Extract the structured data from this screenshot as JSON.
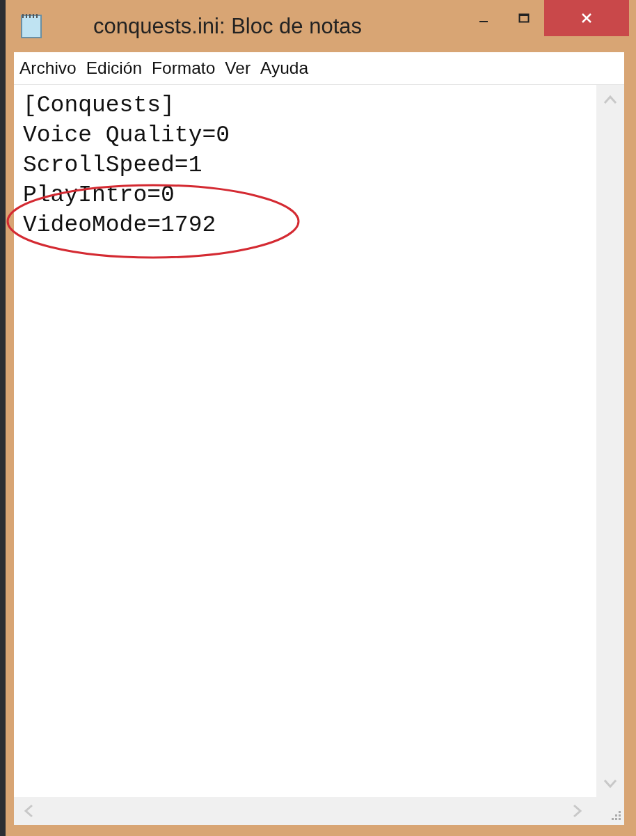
{
  "window": {
    "title": "conquests.ini: Bloc de notas"
  },
  "menu": [
    "Archivo",
    "Edición",
    "Formato",
    "Ver",
    "Ayuda"
  ],
  "lines": [
    "[Conquests]",
    "Voice Quality=0",
    "ScrollSpeed=1",
    "PlayIntro=0",
    "VideoMode=1792"
  ]
}
